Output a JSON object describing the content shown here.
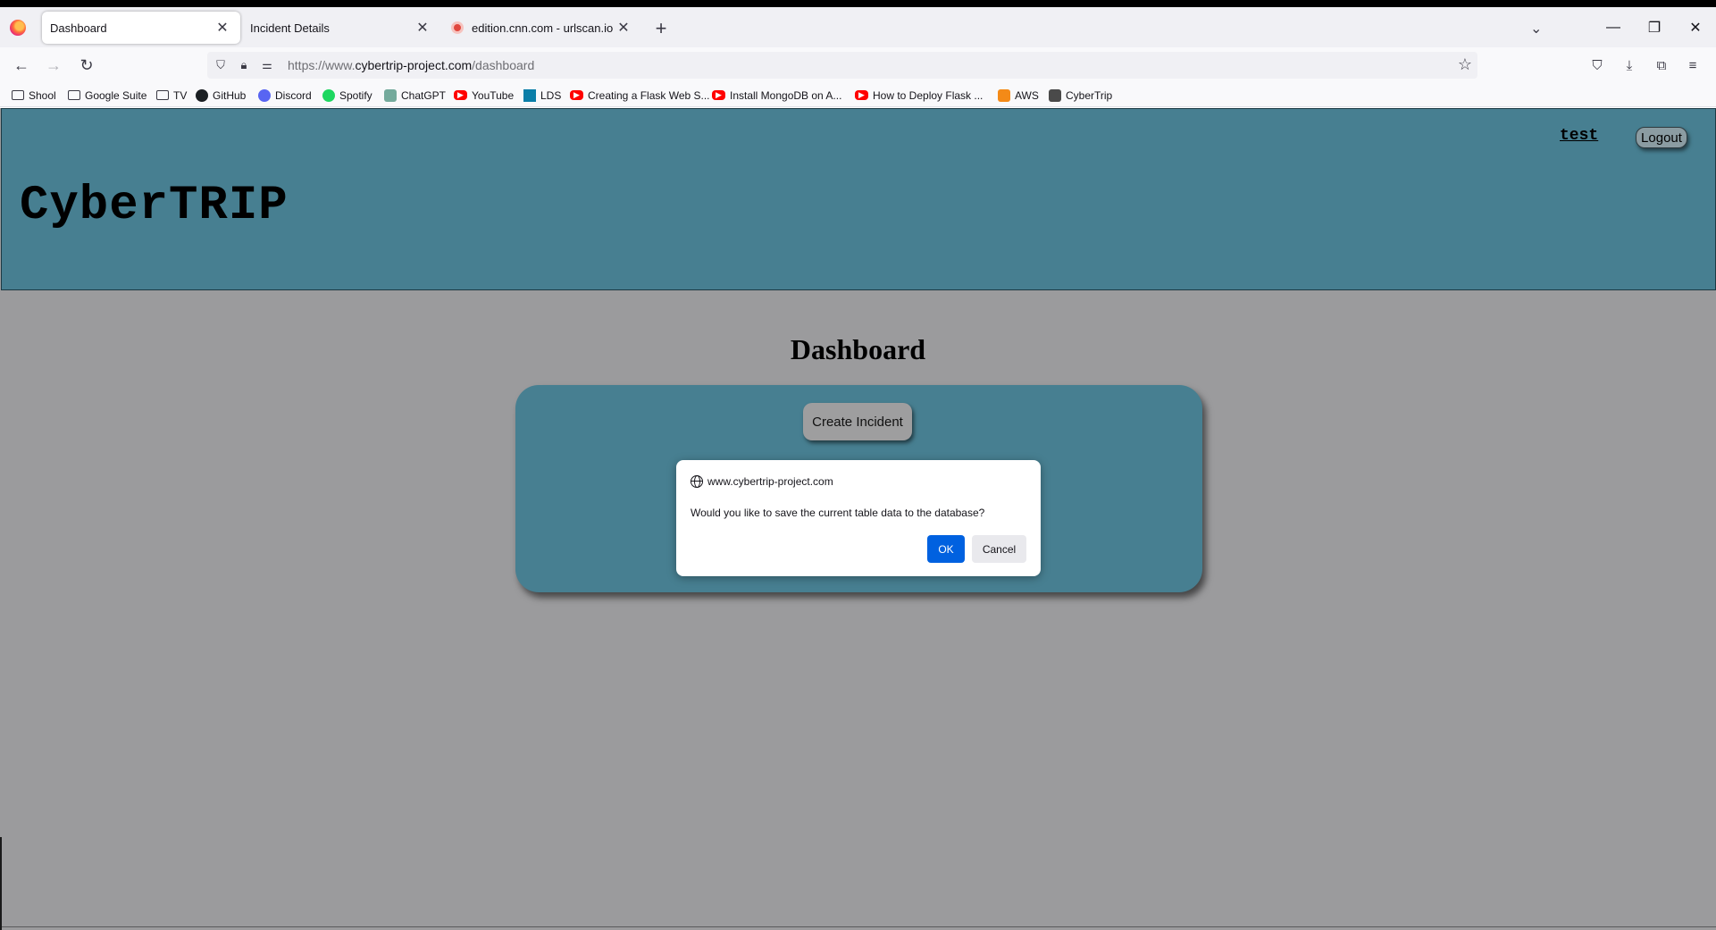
{
  "browser": {
    "tabs": [
      {
        "label": "Dashboard",
        "active": true
      },
      {
        "label": "Incident Details",
        "active": false
      },
      {
        "label": "edition.cnn.com - urlscan.io",
        "active": false
      }
    ],
    "url": {
      "prefix": "https://www.",
      "domain": "cybertrip-project.com",
      "path": "/dashboard"
    },
    "bookmarks": [
      {
        "label": "Shool",
        "icon": "folder-icon"
      },
      {
        "label": "Google Suite",
        "icon": "folder-icon"
      },
      {
        "label": "TV",
        "icon": "folder-icon"
      },
      {
        "label": "GitHub",
        "icon": "github-icon"
      },
      {
        "label": "Discord",
        "icon": "discord-icon"
      },
      {
        "label": "Spotify",
        "icon": "spotify-icon"
      },
      {
        "label": "ChatGPT",
        "icon": "chatgpt-icon"
      },
      {
        "label": "YouTube",
        "icon": "youtube-icon"
      },
      {
        "label": "LDS",
        "icon": "lds-icon"
      },
      {
        "label": "Creating a Flask Web S...",
        "icon": "youtube-icon"
      },
      {
        "label": "Install MongoDB on A...",
        "icon": "youtube-icon"
      },
      {
        "label": "How to Deploy Flask ...",
        "icon": "youtube-icon"
      },
      {
        "label": "AWS",
        "icon": "aws-icon"
      },
      {
        "label": "CyberTrip",
        "icon": "cybertrip-icon"
      }
    ]
  },
  "site": {
    "title": "CyberTRIP",
    "user": "test",
    "logout_label": "Logout",
    "page_heading": "Dashboard",
    "create_incident_label": "Create Incident"
  },
  "dialog": {
    "origin": "www.cybertrip-project.com",
    "message": "Would you like to save the current table data to the database?",
    "ok_label": "OK",
    "cancel_label": "Cancel"
  },
  "colors": {
    "header_bg": "#477f91",
    "page_bg": "#9b9b9d",
    "ok_button": "#0061e0"
  }
}
